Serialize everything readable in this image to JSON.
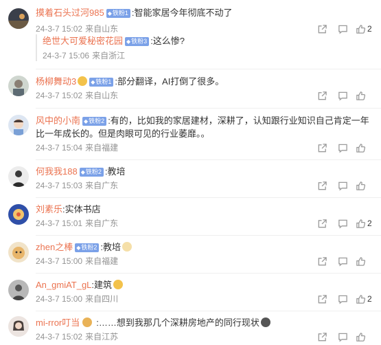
{
  "comments": [
    {
      "user": "摸着石头过河985",
      "badge": "铁粉1",
      "text": ":智能家居今年彻底不动了",
      "time": "24-3-7 15:02",
      "location": "来自山东",
      "likes": "2",
      "reply": {
        "user": "绝世大可爱秘密花园",
        "badge": "铁粉3",
        "text": ":这么惨?",
        "time": "24-3-7 15:06",
        "location": "来自浙江"
      }
    },
    {
      "user": "杨柳舞动3",
      "badge": "铁粉1",
      "text": ":部分翻译，AI打倒了很多。",
      "time": "24-3-7 15:02",
      "location": "来自山东",
      "likes": ""
    },
    {
      "user": "风中的小南",
      "badge": "铁粉2",
      "text": ":有的，比如我的家居建材，深耕了，认知跟行业知识自己肯定一年比一年成长的。但是肉眼可见的行业萎靡。。",
      "time": "24-3-7 15:04",
      "location": "来自福建",
      "likes": ""
    },
    {
      "user": "何我我188",
      "badge": "铁粉2",
      "text": ":教培",
      "time": "24-3-7 15:03",
      "location": "来自广东",
      "likes": ""
    },
    {
      "user": "刘素乐",
      "badge": "",
      "text": ":实体书店",
      "time": "24-3-7 15:01",
      "location": "来自广东",
      "likes": "2"
    },
    {
      "user": "zhen之棒",
      "badge": "铁粉2",
      "text": ":教培",
      "time": "24-3-7 15:00",
      "location": "来自福建",
      "likes": ""
    },
    {
      "user": "An_gmiAT_gL",
      "badge": "",
      "text": ":建筑",
      "time": "24-3-7 15:00",
      "location": "来自四川",
      "likes": "2"
    },
    {
      "user": "mi-rror叮当",
      "badge": "",
      "text": ":……想到我那几个深耕房地产的同行现状",
      "time": "24-3-7 15:02",
      "location": "来自江苏",
      "likes": ""
    }
  ],
  "colors": {
    "username": "#eb7350",
    "badge": "#7ba1e8",
    "meta": "#939393",
    "text": "#333333"
  },
  "icons": {
    "share": "share-icon",
    "comment": "comment-icon",
    "like": "thumbs-up-icon"
  }
}
